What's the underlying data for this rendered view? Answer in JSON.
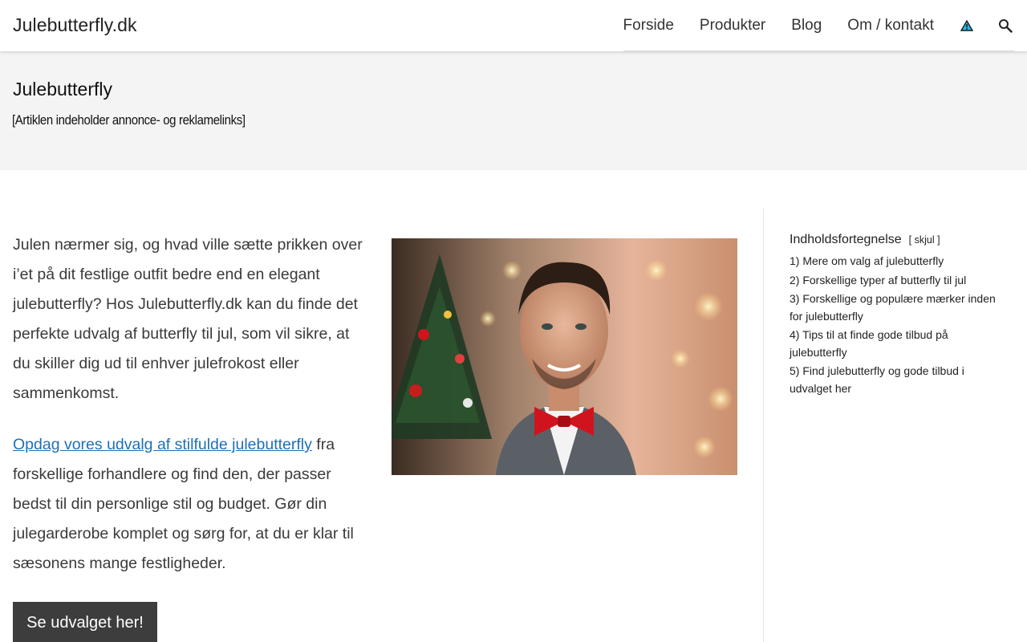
{
  "site": {
    "title": "Julebutterfly.dk"
  },
  "nav": {
    "items": [
      "Forside",
      "Produkter",
      "Blog",
      "Om / kontakt"
    ],
    "icons": [
      "warning-icon",
      "search-icon"
    ]
  },
  "hero": {
    "title": "Julebutterfly",
    "notice": "[Artiklen indeholder annonce- og reklamelinks]"
  },
  "article": {
    "intro": "Julen nærmer sig, og hvad ville sætte prikken over i’et på dit festlige outfit bedre end en elegant julebutterfly? Hos Julebutterfly.dk kan du finde det perfekte udvalg af butterfly til jul, som vil sikre, at du skiller dig ud til enhver julefrokost eller sammenkomst.",
    "link_text": "Opdag vores udvalg af stilfulde julebutterfly",
    "after_link": " fra forskellige forhandlere og find den, der passer bedst til din personlige stil og budget. Gør din julegarderobe komplet og sørg for, at du er klar til sæsonens mange festligheder.",
    "cta": "Se udvalget her!"
  },
  "toc": {
    "title": "Indholdsfortegnelse",
    "toggle": "[ skjul ]",
    "items": [
      "1) Mere om valg af julebutterfly",
      "2) Forskellige typer af butterfly til jul",
      "3) Forskellige og populære mærker inden for julebutterfly",
      "4) Tips til at finde gode tilbud på julebutterfly",
      "5) Find julebutterfly og gode tilbud i udvalget her"
    ]
  },
  "colors": {
    "link": "#1e6fb8",
    "cta_bg": "#3d3d3d",
    "hero_bg": "#f4f4f4",
    "bowtie": "#d0141e"
  }
}
